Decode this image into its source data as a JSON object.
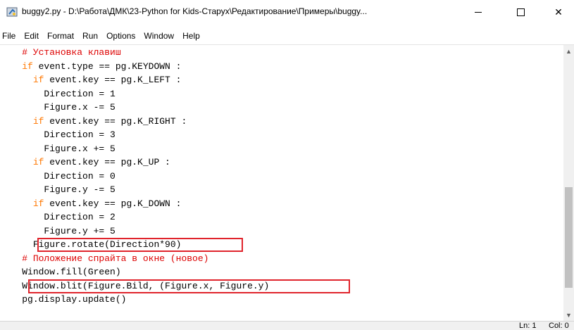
{
  "window": {
    "title": "buggy2.py - D:\\Работа\\ДМК\\23-Python for Kids-Старух\\Редактирование\\Примеры\\buggy...",
    "minimize_glyph": "minimize",
    "maximize_glyph": "maximize",
    "close_glyph": "✕"
  },
  "menu": {
    "items": [
      "File",
      "Edit",
      "Format",
      "Run",
      "Options",
      "Window",
      "Help"
    ]
  },
  "code": {
    "lines": [
      {
        "indent": "    ",
        "parts": [
          {
            "t": "# Установка клавиш",
            "c": "cm"
          }
        ]
      },
      {
        "indent": "    ",
        "parts": [
          {
            "t": "if",
            "c": "kw"
          },
          {
            "t": " event.type == pg.KEYDOWN :",
            "c": ""
          }
        ]
      },
      {
        "indent": "      ",
        "parts": [
          {
            "t": "if",
            "c": "kw"
          },
          {
            "t": " event.key == pg.K_LEFT :",
            "c": ""
          }
        ]
      },
      {
        "indent": "        ",
        "parts": [
          {
            "t": "Direction = 1",
            "c": ""
          }
        ]
      },
      {
        "indent": "        ",
        "parts": [
          {
            "t": "Figure.x -= 5",
            "c": ""
          }
        ]
      },
      {
        "indent": "      ",
        "parts": [
          {
            "t": "if",
            "c": "kw"
          },
          {
            "t": " event.key == pg.K_RIGHT :",
            "c": ""
          }
        ]
      },
      {
        "indent": "        ",
        "parts": [
          {
            "t": "Direction = 3",
            "c": ""
          }
        ]
      },
      {
        "indent": "        ",
        "parts": [
          {
            "t": "Figure.x += 5",
            "c": ""
          }
        ]
      },
      {
        "indent": "      ",
        "parts": [
          {
            "t": "if",
            "c": "kw"
          },
          {
            "t": " event.key == pg.K_UP :",
            "c": ""
          }
        ]
      },
      {
        "indent": "        ",
        "parts": [
          {
            "t": "Direction = 0",
            "c": ""
          }
        ]
      },
      {
        "indent": "        ",
        "parts": [
          {
            "t": "Figure.y -= 5",
            "c": ""
          }
        ]
      },
      {
        "indent": "      ",
        "parts": [
          {
            "t": "if",
            "c": "kw"
          },
          {
            "t": " event.key == pg.K_DOWN :",
            "c": ""
          }
        ]
      },
      {
        "indent": "        ",
        "parts": [
          {
            "t": "Direction = 2",
            "c": ""
          }
        ]
      },
      {
        "indent": "        ",
        "parts": [
          {
            "t": "Figure.y += 5",
            "c": ""
          }
        ]
      },
      {
        "indent": "      ",
        "parts": [
          {
            "t": "Figure.rotate(Direction*90)",
            "c": ""
          }
        ]
      },
      {
        "indent": "    ",
        "parts": [
          {
            "t": "# Положение спрайта в окне (новое)",
            "c": "cm"
          }
        ]
      },
      {
        "indent": "    ",
        "parts": [
          {
            "t": "Window.fill(Green)",
            "c": ""
          }
        ]
      },
      {
        "indent": "    ",
        "parts": [
          {
            "t": "Window.blit(Figure.Bild, (Figure.x, Figure.y)",
            "c": ""
          }
        ]
      },
      {
        "indent": "    ",
        "parts": [
          {
            "t": "pg.display.update()",
            "c": ""
          }
        ]
      }
    ],
    "highlighted_lines": [
      14,
      17
    ]
  },
  "colors": {
    "keyword": "#ff7700",
    "comment": "#dd0000",
    "highlight_box": "#e0242c"
  },
  "status": {
    "line": "Ln: 1",
    "col": "Col: 0"
  }
}
